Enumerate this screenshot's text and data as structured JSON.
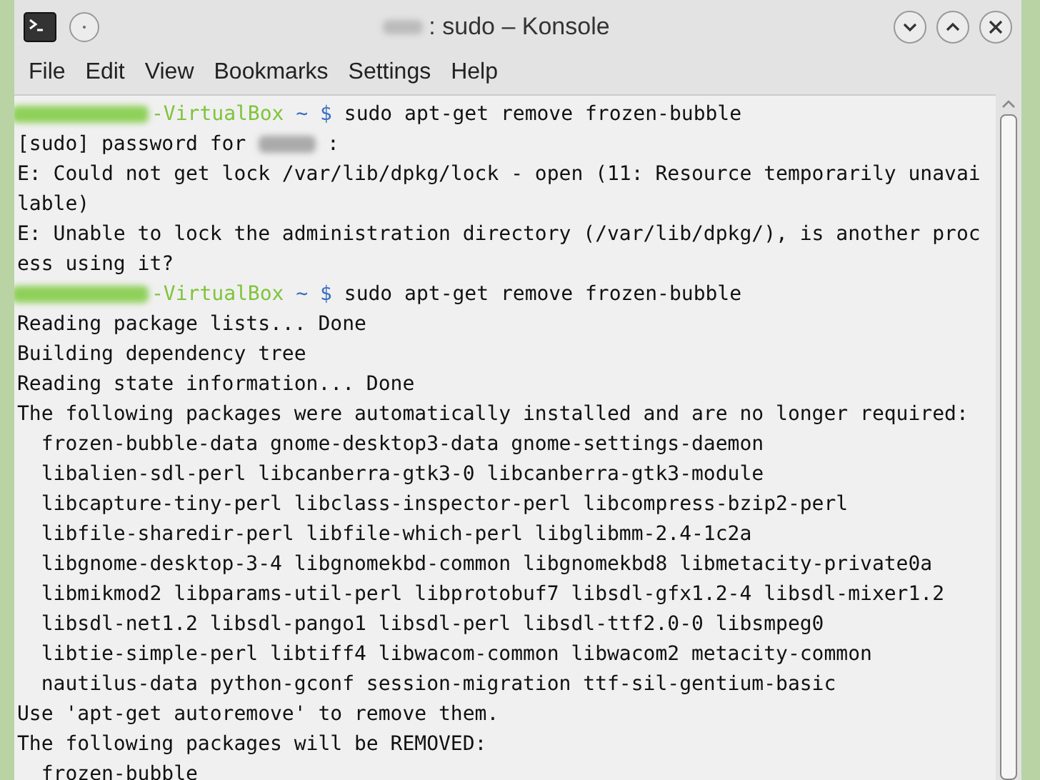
{
  "window": {
    "title": ": sudo – Konsole"
  },
  "menu": [
    "File",
    "Edit",
    "View",
    "Bookmarks",
    "Settings",
    "Help"
  ],
  "terminal": {
    "lines": [
      {
        "kind": "prompt",
        "host": "-VirtualBox",
        "path": "~ $",
        "command": "sudo apt-get remove frozen-bubble"
      },
      {
        "kind": "password",
        "text": "[sudo] password for",
        "suffix": ":"
      },
      {
        "kind": "output",
        "text": "E: Could not get lock /var/lib/dpkg/lock - open (11: Resource temporarily unavai"
      },
      {
        "kind": "output",
        "text": "lable)"
      },
      {
        "kind": "output",
        "text": "E: Unable to lock the administration directory (/var/lib/dpkg/), is another proc"
      },
      {
        "kind": "output",
        "text": "ess using it?"
      },
      {
        "kind": "prompt",
        "host": "-VirtualBox",
        "path": "~ $",
        "command": "sudo apt-get remove frozen-bubble"
      },
      {
        "kind": "output",
        "text": "Reading package lists... Done"
      },
      {
        "kind": "output",
        "text": "Building dependency tree"
      },
      {
        "kind": "output",
        "text": "Reading state information... Done"
      },
      {
        "kind": "output",
        "text": "The following packages were automatically installed and are no longer required:"
      },
      {
        "kind": "output",
        "text": "  frozen-bubble-data gnome-desktop3-data gnome-settings-daemon"
      },
      {
        "kind": "output",
        "text": "  libalien-sdl-perl libcanberra-gtk3-0 libcanberra-gtk3-module"
      },
      {
        "kind": "output",
        "text": "  libcapture-tiny-perl libclass-inspector-perl libcompress-bzip2-perl"
      },
      {
        "kind": "output",
        "text": "  libfile-sharedir-perl libfile-which-perl libglibmm-2.4-1c2a"
      },
      {
        "kind": "output",
        "text": "  libgnome-desktop-3-4 libgnomekbd-common libgnomekbd8 libmetacity-private0a"
      },
      {
        "kind": "output",
        "text": "  libmikmod2 libparams-util-perl libprotobuf7 libsdl-gfx1.2-4 libsdl-mixer1.2"
      },
      {
        "kind": "output",
        "text": "  libsdl-net1.2 libsdl-pango1 libsdl-perl libsdl-ttf2.0-0 libsmpeg0"
      },
      {
        "kind": "output",
        "text": "  libtie-simple-perl libtiff4 libwacom-common libwacom2 metacity-common"
      },
      {
        "kind": "output",
        "text": "  nautilus-data python-gconf session-migration ttf-sil-gentium-basic"
      },
      {
        "kind": "output",
        "text": "Use 'apt-get autoremove' to remove them."
      },
      {
        "kind": "output",
        "text": "The following packages will be REMOVED:"
      },
      {
        "kind": "output",
        "text": "  frozen-bubble"
      }
    ]
  }
}
